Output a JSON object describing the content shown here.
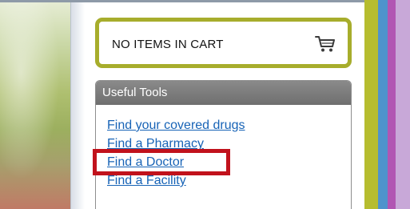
{
  "cart": {
    "label": "NO ITEMS IN CART",
    "icon": "shopping-cart-icon"
  },
  "useful_tools": {
    "title": "Useful Tools",
    "links": [
      {
        "label": "Find your covered drugs"
      },
      {
        "label": "Find a Pharmacy"
      },
      {
        "label": "Find a Doctor",
        "highlighted": true
      },
      {
        "label": "Find a Facility"
      }
    ]
  },
  "colors": {
    "cart_border": "#a7ad2c",
    "header_bg": "#7d7d7d",
    "link": "#1763b6",
    "highlight": "#c1121c",
    "stripe_olive": "#b6bd2f",
    "stripe_blue": "#4f93cc",
    "stripe_purple": "#b156b3"
  }
}
